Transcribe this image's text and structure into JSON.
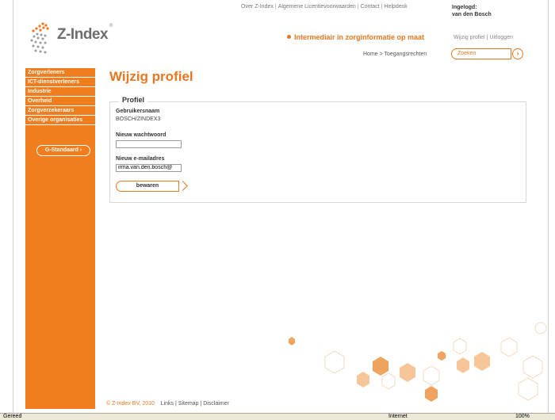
{
  "header": {
    "top_links": [
      "Over Z-Index",
      "Algemene Licentievoorwaarden",
      "Contact",
      "Helpdesk"
    ],
    "user_label": "Ingelogd:",
    "user_name": "van den Bosch",
    "user_links": [
      "Wijzig profiel",
      "Uitloggen"
    ],
    "logo_text": "Z-Index",
    "tagline": "Intermediair in zorginformatie op maat",
    "breadcrumb": "Home > Toegangsrechten",
    "search_placeholder": "Zoeken"
  },
  "sidebar": {
    "items": [
      {
        "label": "Zorgverleners"
      },
      {
        "label": "ICT-dienstverleners"
      },
      {
        "label": "Industrie"
      },
      {
        "label": "Overheid"
      },
      {
        "label": "Zorgverzekeraars"
      },
      {
        "label": "Overige organisaties"
      }
    ],
    "g_standaard": "G-Standaard"
  },
  "main": {
    "title": "Wijzig profiel",
    "legend": "Profiel",
    "username_label": "Gebruikersnaam",
    "username_value": "BOSCH/ZINDEX3",
    "password_label": "Nieuw wachtwoord",
    "password_value": "",
    "email_label": "Nieuw e-mailadres",
    "email_value": "irma.van.den.bosch@",
    "save_label": "bewaren"
  },
  "footer": {
    "copyright": "© Z-Index BV, 2010",
    "links": [
      "Links",
      "Sitemap",
      "Disclaimer"
    ]
  },
  "statusbar": {
    "left": "Gereed",
    "zone": "Internet",
    "zoom": "100%"
  },
  "colors": {
    "accent": "#e87722",
    "sidebar": "#f07d1e"
  }
}
